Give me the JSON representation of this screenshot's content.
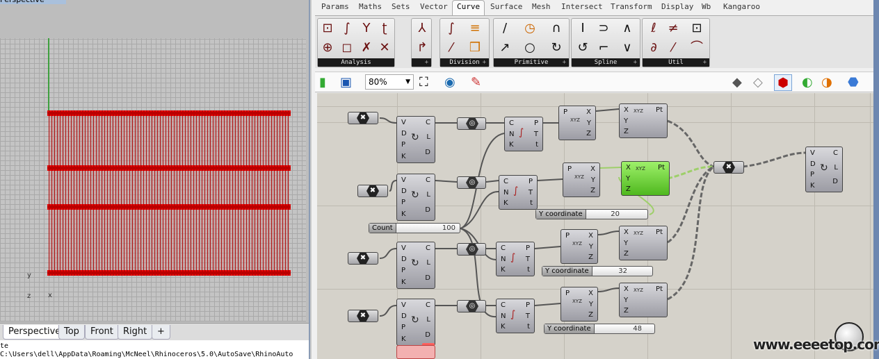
{
  "viewport": {
    "title": "Perspective",
    "axis_y": "y",
    "axis_z": "z",
    "axis_x": "x",
    "tabs": [
      {
        "label": "Perspective",
        "active": true
      },
      {
        "label": "Top"
      },
      {
        "label": "Front"
      },
      {
        "label": "Right"
      },
      {
        "label": "+"
      }
    ],
    "mesh_color": "#b00000"
  },
  "command": {
    "line1": "te",
    "line2": "C:\\Users\\dell\\AppData\\Roaming\\McNeel\\Rhinoceros\\5.0\\AutoSave\\RhinoAuto"
  },
  "grasshopper": {
    "tabs": [
      "Params",
      "Maths",
      "Sets",
      "Vector",
      "Curve",
      "Surface",
      "Mesh",
      "Intersect",
      "Transform",
      "Display",
      "Wb",
      "Kangaroo"
    ],
    "active_tab": "Curve",
    "groups": [
      "Analysis",
      "Division",
      "Primitive",
      "Spline",
      "Util"
    ],
    "zoom": "80%",
    "sliders": {
      "count": {
        "label": "Count",
        "value": "100"
      },
      "y1": {
        "label": "Y coordinate",
        "value": "20"
      },
      "y2": {
        "label": "Y coordinate",
        "value": "32"
      },
      "y3": {
        "label": "Y coordinate",
        "value": "48"
      }
    },
    "ports": {
      "interp_in": [
        "V",
        "D",
        "P",
        "K"
      ],
      "interp_out": [
        "C",
        "L",
        "D"
      ],
      "divide_in": [
        "C",
        "N",
        "K"
      ],
      "divide_out": [
        "P",
        "T",
        "t"
      ],
      "decon_in": "P",
      "decon_out": [
        "X",
        "Y",
        "Z"
      ],
      "con_in": [
        "X",
        "Y",
        "Z"
      ],
      "con_out": "Pt",
      "xyz": "XYZ"
    },
    "selected_color": "#5cc22a"
  },
  "watermark": "www.eeeetop.com"
}
